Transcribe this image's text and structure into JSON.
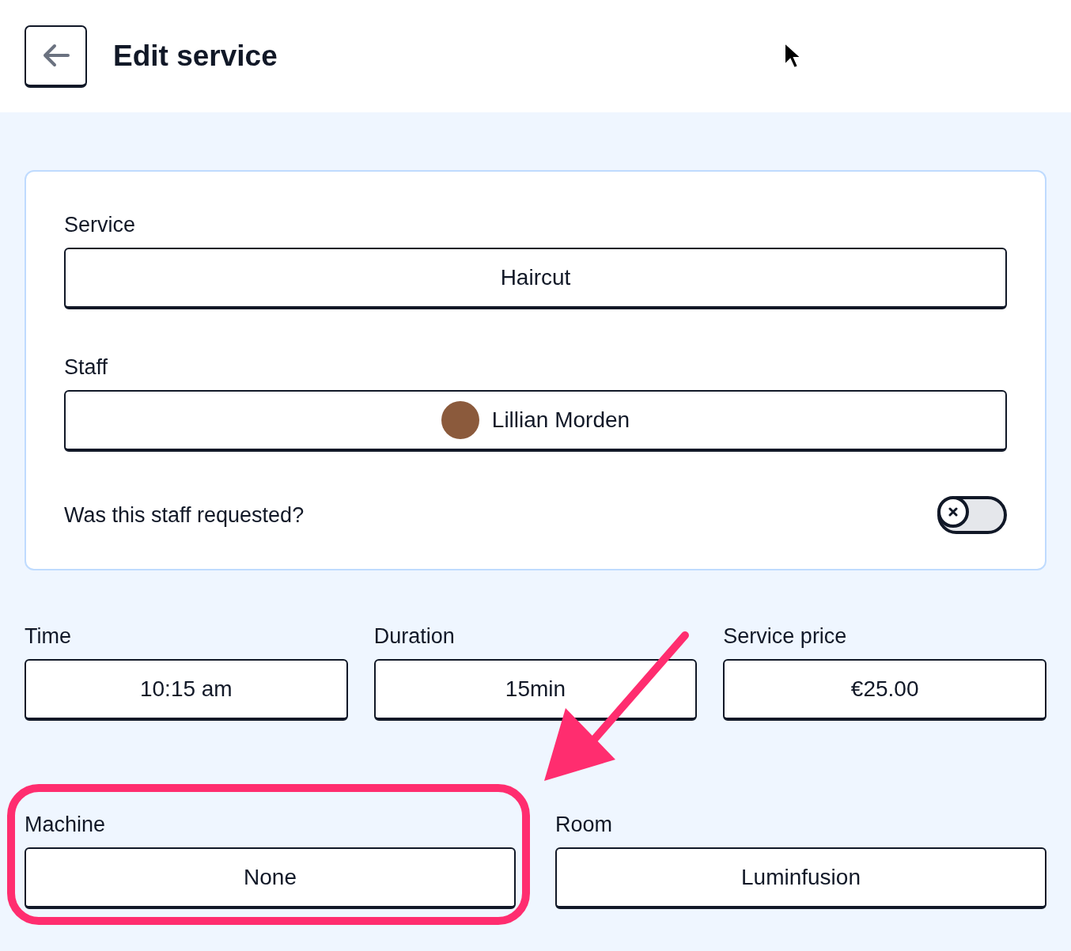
{
  "header": {
    "title": "Edit service"
  },
  "card": {
    "fields": [
      {
        "label": "Service",
        "value": "Haircut",
        "avatar": false
      },
      {
        "label": "Staff",
        "value": "Lillian Morden",
        "avatar": true
      }
    ],
    "toggle": {
      "label": "Was this staff requested?",
      "on": false
    }
  },
  "details": [
    {
      "label": "Time",
      "value": "10:15 am"
    },
    {
      "label": "Duration",
      "value": "15min"
    },
    {
      "label": "Service price",
      "value": "€25.00"
    }
  ],
  "resources": [
    {
      "label": "Machine",
      "value": "None",
      "highlighted": true
    },
    {
      "label": "Room",
      "value": "Luminfusion",
      "highlighted": false
    }
  ]
}
